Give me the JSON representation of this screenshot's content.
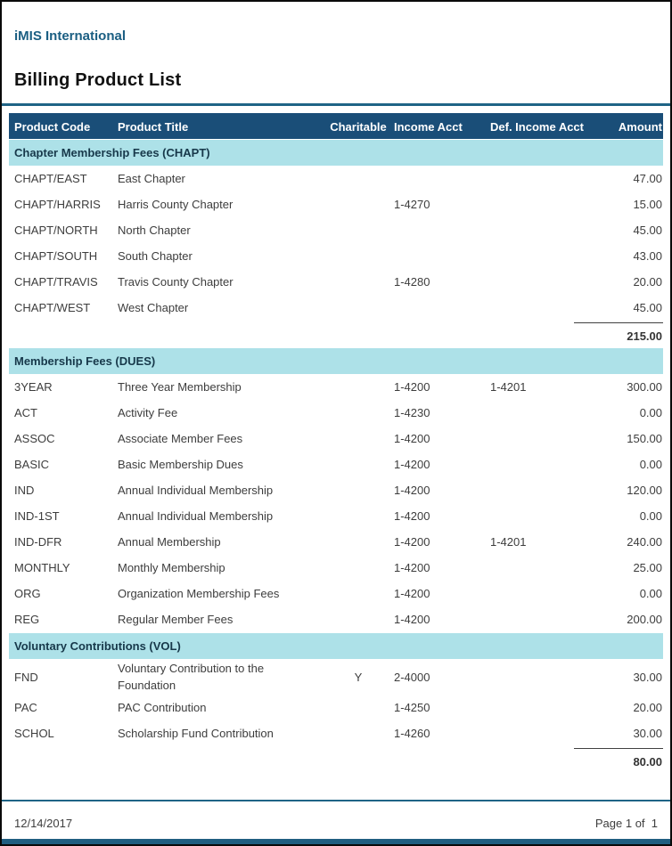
{
  "page": {
    "brand": "iMIS International",
    "title": "Billing Product List",
    "footer": {
      "date": "12/14/2017",
      "page_label": "Page 1 of  1"
    }
  },
  "colors": {
    "header_bg": "#1A4E78",
    "section_bg": "#ADE1E8",
    "rule": "#1F6486",
    "brand_text": "#1A5E82",
    "body_text": "#3D3D3D",
    "bottom_strip": "#205E80"
  },
  "table": {
    "columns": [
      {
        "label": "Product Code",
        "align": "left"
      },
      {
        "label": "Product Title",
        "align": "left"
      },
      {
        "label": "Charitable",
        "align": "center"
      },
      {
        "label": "Income Acct",
        "align": "left"
      },
      {
        "label": "Def. Income Acct",
        "align": "left"
      },
      {
        "label": "Amount",
        "align": "right"
      }
    ],
    "sections": [
      {
        "title": "Chapter Membership Fees (CHAPT)",
        "rows": [
          {
            "code": "CHAPT/EAST",
            "title": "East Chapter",
            "charitable": "",
            "income_acct": "",
            "def_income_acct": "",
            "amount": "47.00"
          },
          {
            "code": "CHAPT/HARRIS",
            "title": "Harris County Chapter",
            "charitable": "",
            "income_acct": "1-4270",
            "def_income_acct": "",
            "amount": "15.00"
          },
          {
            "code": "CHAPT/NORTH",
            "title": "North Chapter",
            "charitable": "",
            "income_acct": "",
            "def_income_acct": "",
            "amount": "45.00"
          },
          {
            "code": "CHAPT/SOUTH",
            "title": "South Chapter",
            "charitable": "",
            "income_acct": "",
            "def_income_acct": "",
            "amount": "43.00"
          },
          {
            "code": "CHAPT/TRAVIS",
            "title": "Travis County Chapter",
            "charitable": "",
            "income_acct": "1-4280",
            "def_income_acct": "",
            "amount": "20.00"
          },
          {
            "code": "CHAPT/WEST",
            "title": "West Chapter",
            "charitable": "",
            "income_acct": "",
            "def_income_acct": "",
            "amount": "45.00"
          }
        ],
        "subtotal": "215.00"
      },
      {
        "title": "Membership Fees (DUES)",
        "rows": [
          {
            "code": "3YEAR",
            "title": "Three Year Membership",
            "charitable": "",
            "income_acct": "1-4200",
            "def_income_acct": "1-4201",
            "amount": "300.00"
          },
          {
            "code": "ACT",
            "title": "Activity Fee",
            "charitable": "",
            "income_acct": "1-4230",
            "def_income_acct": "",
            "amount": "0.00"
          },
          {
            "code": "ASSOC",
            "title": "Associate Member Fees",
            "charitable": "",
            "income_acct": "1-4200",
            "def_income_acct": "",
            "amount": "150.00"
          },
          {
            "code": "BASIC",
            "title": "Basic Membership Dues",
            "charitable": "",
            "income_acct": "1-4200",
            "def_income_acct": "",
            "amount": "0.00"
          },
          {
            "code": "IND",
            "title": "Annual Individual Membership",
            "charitable": "",
            "income_acct": "1-4200",
            "def_income_acct": "",
            "amount": "120.00"
          },
          {
            "code": "IND-1ST",
            "title": "Annual Individual Membership",
            "charitable": "",
            "income_acct": "1-4200",
            "def_income_acct": "",
            "amount": "0.00"
          },
          {
            "code": "IND-DFR",
            "title": "Annual Membership",
            "charitable": "",
            "income_acct": "1-4200",
            "def_income_acct": "1-4201",
            "amount": "240.00"
          },
          {
            "code": "MONTHLY",
            "title": "Monthly Membership",
            "charitable": "",
            "income_acct": "1-4200",
            "def_income_acct": "",
            "amount": "25.00"
          },
          {
            "code": "ORG",
            "title": "Organization Membership Fees",
            "charitable": "",
            "income_acct": "1-4200",
            "def_income_acct": "",
            "amount": "0.00"
          },
          {
            "code": "REG",
            "title": "Regular Member Fees",
            "charitable": "",
            "income_acct": "1-4200",
            "def_income_acct": "",
            "amount": "200.00"
          }
        ],
        "subtotal": null
      },
      {
        "title": "Voluntary Contributions (VOL)",
        "rows": [
          {
            "code": "FND",
            "title": "Voluntary Contribution to the Foundation",
            "charitable": "Y",
            "income_acct": "2-4000",
            "def_income_acct": "",
            "amount": "30.00"
          },
          {
            "code": "PAC",
            "title": "PAC Contribution",
            "charitable": "",
            "income_acct": "1-4250",
            "def_income_acct": "",
            "amount": "20.00"
          },
          {
            "code": "SCHOL",
            "title": "Scholarship Fund Contribution",
            "charitable": "",
            "income_acct": "1-4260",
            "def_income_acct": "",
            "amount": "30.00"
          }
        ],
        "subtotal": "80.00"
      }
    ]
  }
}
